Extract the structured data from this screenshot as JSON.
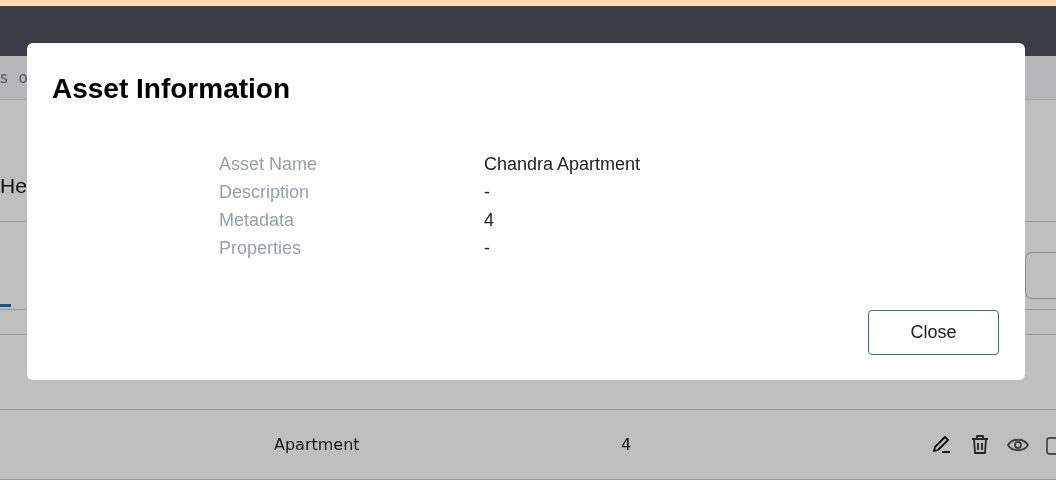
{
  "page": {
    "breadcrumb": "s o",
    "heading": "He",
    "table": {
      "rows": [
        {
          "asset_type": "Apartment",
          "metadata": "4"
        }
      ]
    }
  },
  "dialog": {
    "title": "Asset Information",
    "fields": [
      {
        "label": "Asset Name",
        "value": "Chandra Apartment"
      },
      {
        "label": "Description",
        "value": "-"
      },
      {
        "label": "Metadata",
        "value": "4"
      },
      {
        "label": "Properties",
        "value": "-"
      }
    ],
    "buttons": [
      "Close"
    ]
  }
}
